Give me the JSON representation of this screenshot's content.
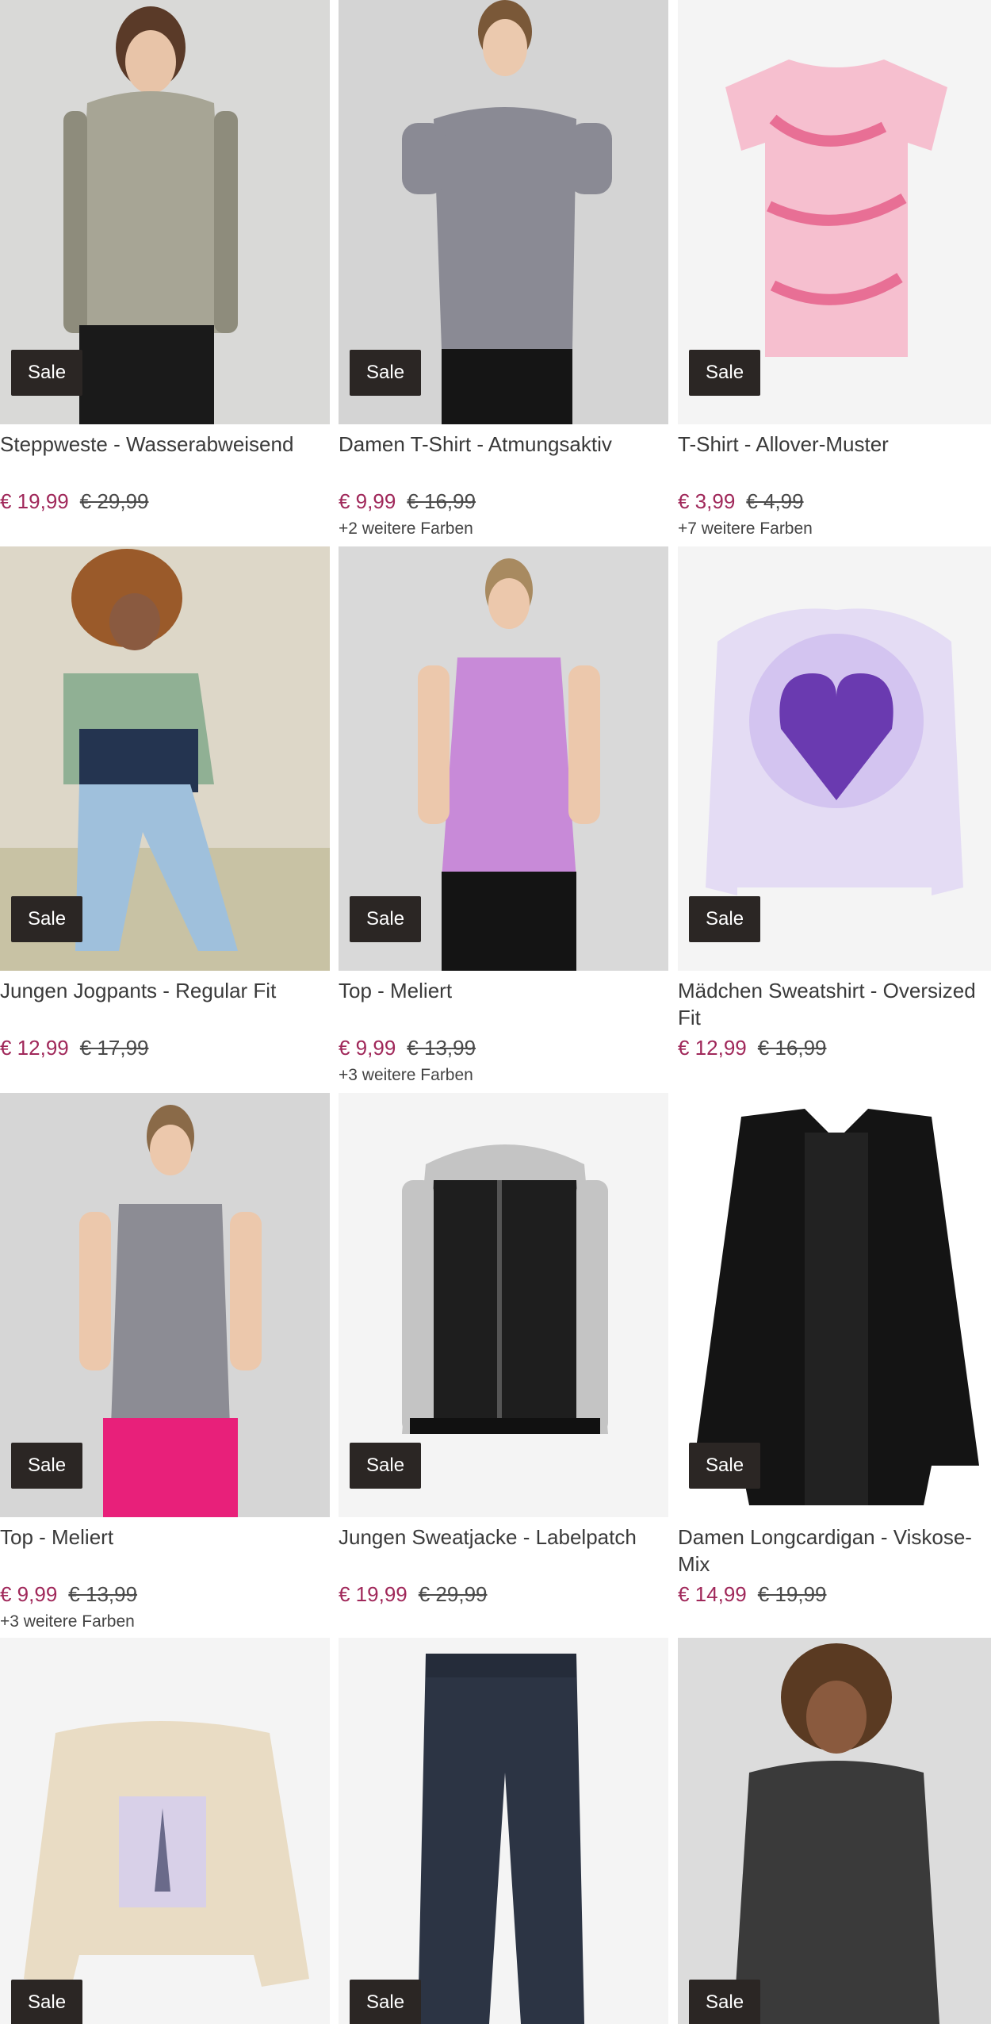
{
  "sale_label": "Sale",
  "colors": {
    "sale_badge_bg": "#2b2624",
    "sale_price": "#a0285a"
  },
  "products": [
    {
      "title": "Steppweste - Wasserabweisend",
      "price": "€ 19,99",
      "old_price": "€ 29,99",
      "more_colors": ""
    },
    {
      "title": "Damen T-Shirt - Atmungsaktiv",
      "price": "€ 9,99",
      "old_price": "€ 16,99",
      "more_colors": "+2 weitere Farben"
    },
    {
      "title": "T-Shirt - Allover-Muster",
      "price": "€ 3,99",
      "old_price": "€ 4,99",
      "more_colors": "+7 weitere Farben"
    },
    {
      "title": "Jungen Jogpants - Regular Fit",
      "price": "€ 12,99",
      "old_price": "€ 17,99",
      "more_colors": ""
    },
    {
      "title": "Top - Meliert",
      "price": "€ 9,99",
      "old_price": "€ 13,99",
      "more_colors": "+3 weitere Farben"
    },
    {
      "title": "Mädchen Sweatshirt - Oversized Fit",
      "price": "€ 12,99",
      "old_price": "€ 16,99",
      "more_colors": ""
    },
    {
      "title": "Top - Meliert",
      "price": "€ 9,99",
      "old_price": "€ 13,99",
      "more_colors": "+3 weitere Farben"
    },
    {
      "title": "Jungen Sweatjacke - Labelpatch",
      "price": "€ 19,99",
      "old_price": "€ 29,99",
      "more_colors": ""
    },
    {
      "title": "Damen Longcardigan - Viskose-Mix",
      "price": "€ 14,99",
      "old_price": "€ 19,99",
      "more_colors": ""
    },
    {
      "title": "",
      "price": "",
      "old_price": "",
      "more_colors": ""
    },
    {
      "title": "",
      "price": "",
      "old_price": "",
      "more_colors": ""
    },
    {
      "title": "",
      "price": "",
      "old_price": "",
      "more_colors": ""
    }
  ]
}
